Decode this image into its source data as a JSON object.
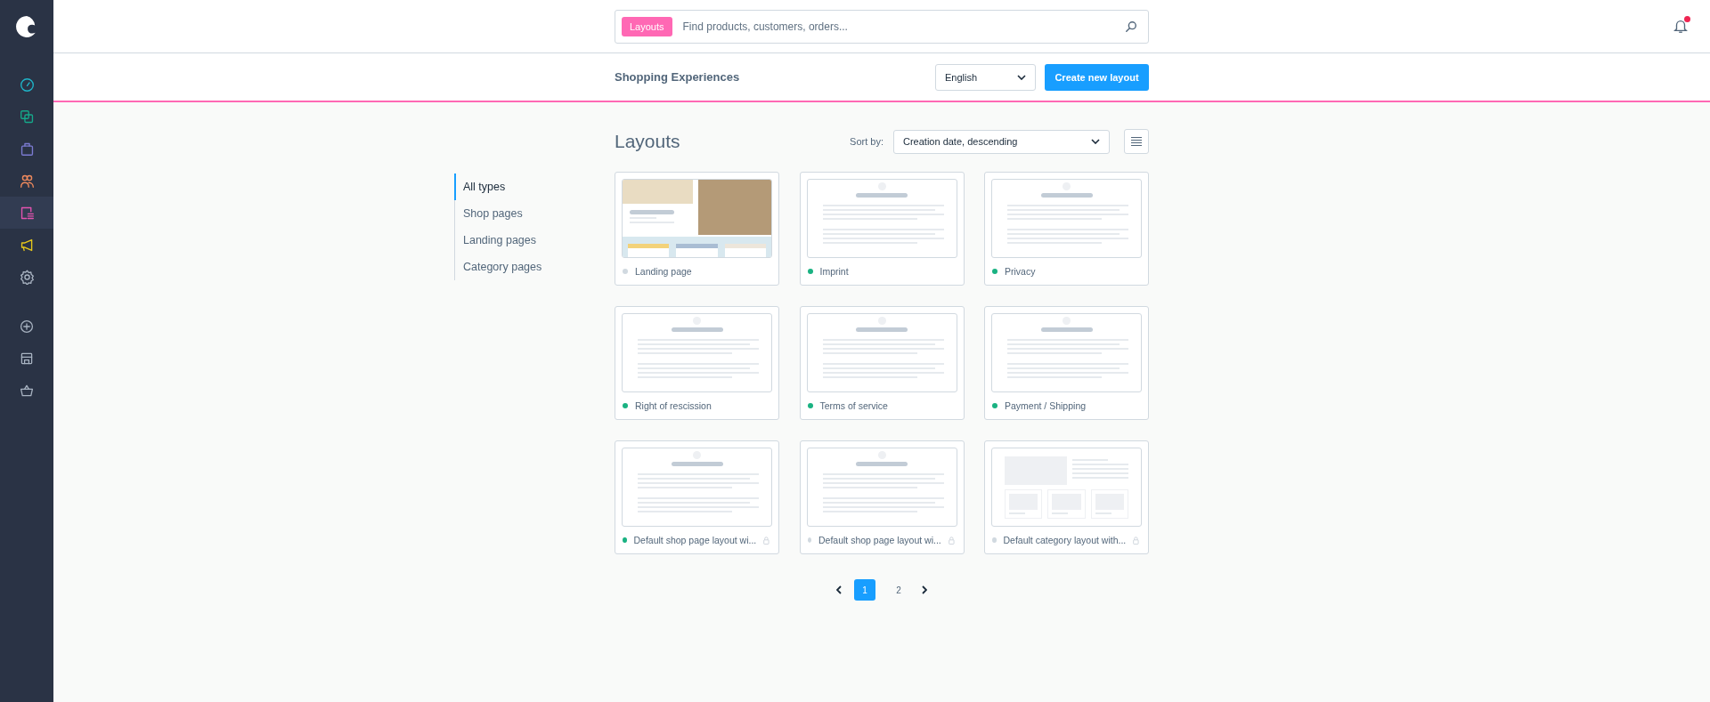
{
  "sidebar": {
    "items": [
      {
        "kind": "gauge",
        "color": "#1fb5c9",
        "selected": false
      },
      {
        "kind": "copies",
        "color": "#16a88a",
        "selected": false
      },
      {
        "kind": "bag",
        "color": "#7b7bd1",
        "selected": false
      },
      {
        "kind": "people",
        "color": "#f08a5d",
        "selected": false
      },
      {
        "kind": "layouts",
        "color": "#e453b0",
        "selected": true
      },
      {
        "kind": "megaphone",
        "color": "#e7c81a",
        "selected": false
      },
      {
        "kind": "gear",
        "color": "#a9b4c2",
        "selected": false
      }
    ],
    "bottom_items": [
      {
        "kind": "plus"
      },
      {
        "kind": "store"
      },
      {
        "kind": "basket"
      }
    ]
  },
  "search": {
    "tag": "Layouts",
    "placeholder": "Find products, customers, orders..."
  },
  "notifications": {
    "unread": true
  },
  "header": {
    "title": "Shopping Experiences",
    "language": "English",
    "create_button": "Create new layout"
  },
  "filters": [
    {
      "label": "All types",
      "selected": true
    },
    {
      "label": "Shop pages",
      "selected": false
    },
    {
      "label": "Landing pages",
      "selected": false
    },
    {
      "label": "Category pages",
      "selected": false
    }
  ],
  "content": {
    "title": "Layouts",
    "sort_label": "Sort by:",
    "sort_value": "Creation date, descending"
  },
  "layouts": [
    {
      "name": "Landing page",
      "active": false,
      "locked": false,
      "kind": "landing"
    },
    {
      "name": "Imprint",
      "active": true,
      "locked": false,
      "kind": "text"
    },
    {
      "name": "Privacy",
      "active": true,
      "locked": false,
      "kind": "text"
    },
    {
      "name": "Right of rescission",
      "active": true,
      "locked": false,
      "kind": "text"
    },
    {
      "name": "Terms of service",
      "active": true,
      "locked": false,
      "kind": "text"
    },
    {
      "name": "Payment / Shipping",
      "active": true,
      "locked": false,
      "kind": "text"
    },
    {
      "name": "Default shop page layout wi...",
      "active": true,
      "locked": true,
      "kind": "text"
    },
    {
      "name": "Default shop page layout wi...",
      "active": false,
      "locked": true,
      "kind": "text"
    },
    {
      "name": "Default category layout with...",
      "active": false,
      "locked": true,
      "kind": "category"
    }
  ],
  "pagination": {
    "pages": [
      {
        "label": "1",
        "selected": true
      },
      {
        "label": "2",
        "selected": false
      }
    ]
  }
}
